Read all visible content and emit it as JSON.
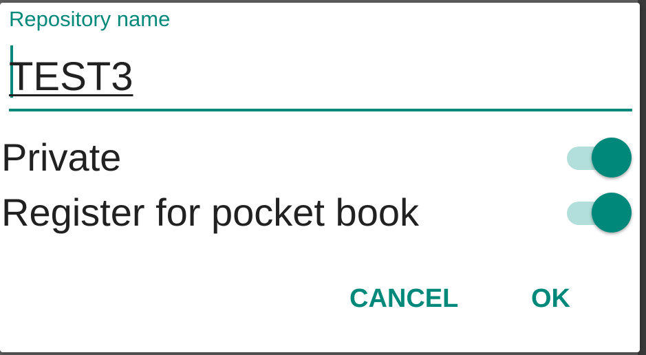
{
  "dialog": {
    "field_label": "Repository name",
    "repository_name_value": "TEST3",
    "switches": [
      {
        "label": "Private",
        "checked": true
      },
      {
        "label": "Register for pocket book",
        "checked": true
      }
    ],
    "cancel_label": "CANCEL",
    "ok_label": "OK"
  },
  "colors": {
    "accent": "#00897b",
    "track": "#b2dfdb",
    "text": "#212121"
  }
}
